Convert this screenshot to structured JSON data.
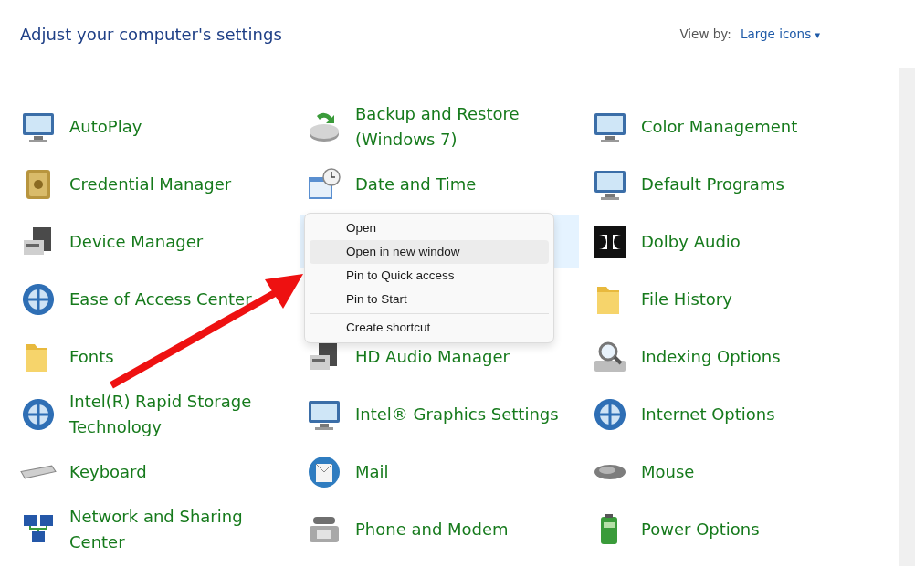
{
  "header": {
    "title": "Adjust your computer's settings",
    "view_by_label": "View by:",
    "view_by_value": "Large icons",
    "caret": "▾"
  },
  "items": [
    {
      "kind": "item",
      "label": "AutoPlay",
      "selected": false
    },
    {
      "kind": "item",
      "label": "Backup and Restore (Windows 7)",
      "selected": false
    },
    {
      "kind": "item",
      "label": "Color Management",
      "selected": false
    },
    {
      "kind": "item",
      "label": "Credential Manager",
      "selected": false
    },
    {
      "kind": "item",
      "label": "Date and Time",
      "selected": false
    },
    {
      "kind": "item",
      "label": "Default Programs",
      "selected": false
    },
    {
      "kind": "item",
      "label": "Device Manager",
      "selected": false
    },
    {
      "kind": "covered",
      "selected": true
    },
    {
      "kind": "item",
      "label": "Dolby Audio",
      "selected": false
    },
    {
      "kind": "item",
      "label": "Ease of Access Center",
      "selected": false
    },
    {
      "kind": "covered",
      "selected": false
    },
    {
      "kind": "item",
      "label": "File History",
      "selected": false
    },
    {
      "kind": "item",
      "label": "Fonts",
      "selected": false
    },
    {
      "kind": "item",
      "label": "HD Audio Manager",
      "selected": false
    },
    {
      "kind": "item",
      "label": "Indexing Options",
      "selected": false
    },
    {
      "kind": "item",
      "label": "Intel(R) Rapid Storage Technology",
      "selected": false
    },
    {
      "kind": "item",
      "label": "Intel® Graphics Settings",
      "selected": false
    },
    {
      "kind": "item",
      "label": "Internet Options",
      "selected": false
    },
    {
      "kind": "item",
      "label": "Keyboard",
      "selected": false
    },
    {
      "kind": "item",
      "label": "Mail",
      "selected": false
    },
    {
      "kind": "item",
      "label": "Mouse",
      "selected": false
    },
    {
      "kind": "item",
      "label": "Network and Sharing Center",
      "selected": false
    },
    {
      "kind": "item",
      "label": "Phone and Modem",
      "selected": false
    },
    {
      "kind": "item",
      "label": "Power Options",
      "selected": false
    }
  ],
  "context_menu": [
    {
      "kind": "entry",
      "label": "Open",
      "selected": false
    },
    {
      "kind": "entry",
      "label": "Open in new window",
      "selected": true
    },
    {
      "kind": "entry",
      "label": "Pin to Quick access",
      "selected": false
    },
    {
      "kind": "entry",
      "label": "Pin to Start",
      "selected": false
    },
    {
      "kind": "separator"
    },
    {
      "kind": "entry",
      "label": "Create shortcut",
      "selected": false
    }
  ]
}
